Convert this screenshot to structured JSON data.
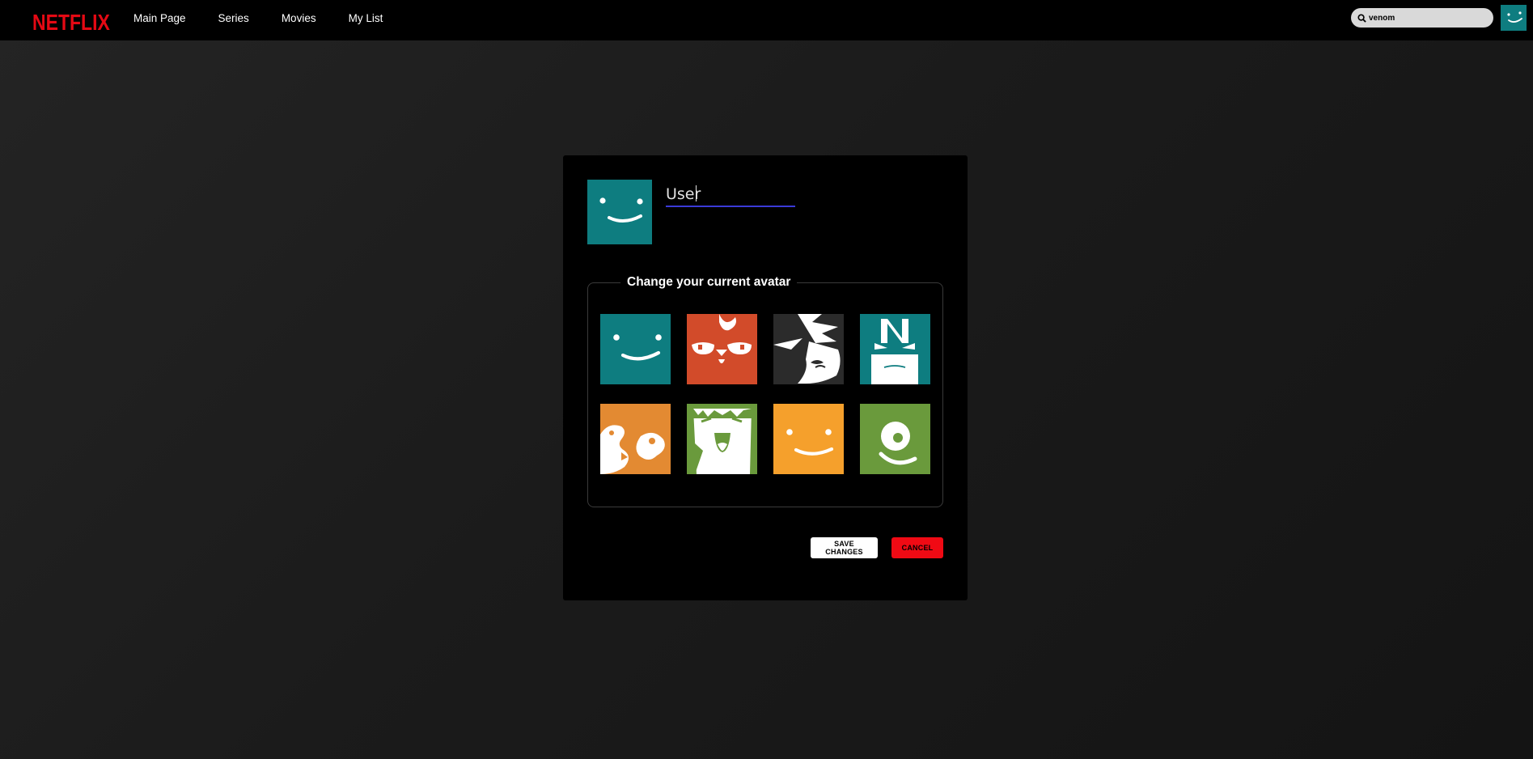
{
  "navbar": {
    "logo": "NETFLIX",
    "links": [
      "Main Page",
      "Series",
      "Movies",
      "My List"
    ],
    "search": {
      "value": "venom",
      "icon": "search-icon"
    },
    "profile_avatar": "smile-face-teal"
  },
  "profile_editor": {
    "name_value": "User",
    "current_avatar": "smile-face-teal",
    "avatar_section_title": "Change your current avatar",
    "avatars": [
      {
        "name": "smile-face-teal",
        "color": "#0e7d80"
      },
      {
        "name": "red-chicken-face",
        "color": "#d24b2a"
      },
      {
        "name": "bandana-bandit",
        "color": "#2b2b2b"
      },
      {
        "name": "n-robot-face",
        "color": "#0e7d80"
      },
      {
        "name": "orange-blob-creature",
        "color": "#e38a32"
      },
      {
        "name": "green-monster-face",
        "color": "#6a9a3c"
      },
      {
        "name": "smile-face-orange",
        "color": "#f5a02c"
      },
      {
        "name": "green-one-eye",
        "color": "#6a9a3c"
      }
    ],
    "save_label": "SAVE CHANGES",
    "cancel_label": "CANCEL"
  },
  "colors": {
    "brand_red": "#e50914",
    "cancel_red": "#f00a14",
    "input_underline": "#3a3ad8"
  }
}
